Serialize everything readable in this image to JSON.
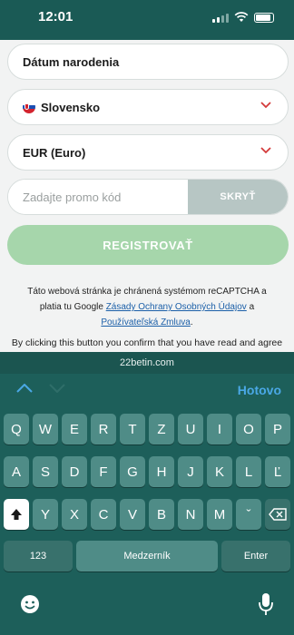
{
  "status_bar": {
    "time": "12:01"
  },
  "form": {
    "birthdate_label": "Dátum narodenia",
    "country_value": "Slovensko",
    "currency_value": "EUR (Euro)",
    "promo_placeholder": "Zadajte promo kód",
    "promo_hide_label": "SKRYŤ",
    "register_label": "REGISTROVAŤ",
    "recaptcha_text_1": "Táto webová stránka je chránená systémom reCAPTCHA a",
    "recaptcha_text_2": "platia tu Google",
    "privacy_link": "Zásady Ochrany Osobných Údajov",
    "recaptcha_and": "a",
    "terms_link": "Používateľská Zmluva",
    "disclaimer": "By clicking this button you confirm that you have read and agree"
  },
  "browser": {
    "url": "22betin.com"
  },
  "accessory": {
    "done_label": "Hotovo"
  },
  "keyboard": {
    "row1": [
      "Q",
      "W",
      "E",
      "R",
      "T",
      "Z",
      "U",
      "I",
      "O",
      "P"
    ],
    "row2": [
      "A",
      "S",
      "D",
      "F",
      "G",
      "H",
      "J",
      "K",
      "L",
      "Ľ"
    ],
    "row3": [
      "Y",
      "X",
      "C",
      "V",
      "B",
      "N",
      "M",
      "ˇ"
    ],
    "numbers_label": "123",
    "space_label": "Medzerník",
    "enter_label": "Enter"
  },
  "colors": {
    "brand_teal": "#1d5f5a",
    "register_green": "#a6d6ab",
    "link_blue": "#1b5fa8",
    "done_blue": "#4aa8e6"
  }
}
